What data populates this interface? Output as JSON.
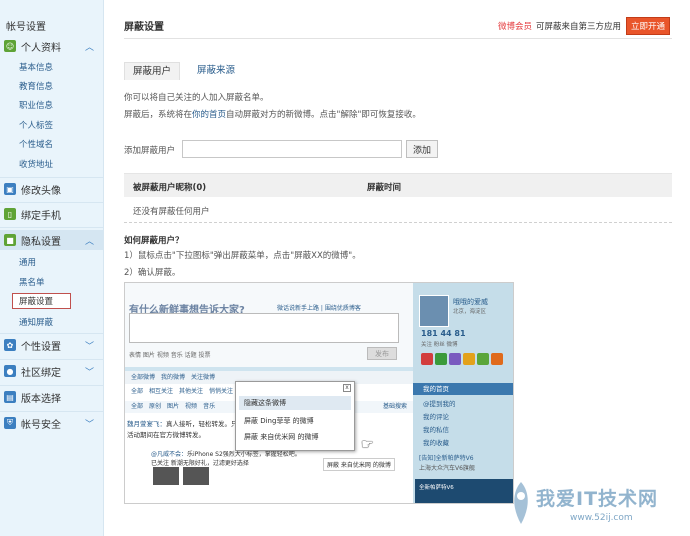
{
  "sidebar": {
    "title": "帐号设置",
    "sections": [
      {
        "label": "个人资料",
        "icon": "person-icon",
        "chevron": "^"
      },
      {
        "label": "修改头像",
        "icon": "avatar-icon"
      },
      {
        "label": "绑定手机",
        "icon": "phone-icon"
      },
      {
        "label": "隐私设置",
        "icon": "lock-icon",
        "chevron": "^"
      },
      {
        "label": "个性设置",
        "icon": "style-icon",
        "chevron": "v"
      },
      {
        "label": "社区绑定",
        "icon": "community-icon",
        "chevron": "v"
      },
      {
        "label": "版本选择",
        "icon": "version-icon"
      },
      {
        "label": "帐号安全",
        "icon": "shield-icon",
        "chevron": "v"
      }
    ],
    "profile_items": [
      "基本信息",
      "教育信息",
      "职业信息",
      "个人标签",
      "个性域名",
      "收货地址"
    ],
    "privacy_items": [
      "通用",
      "黑名单",
      "屏蔽设置",
      "通知屏蔽"
    ]
  },
  "header": {
    "title": "屏蔽设置",
    "vip_link": "微博会员",
    "vip_text": "可屏蔽来自第三方应用",
    "open_button": "立即开通"
  },
  "tabs": {
    "active": "屏蔽用户",
    "other": "屏蔽来源"
  },
  "desc": {
    "line1": "你可以将自己关注的人加入屏蔽名单。",
    "line2_a": "屏蔽后，系统将在",
    "line2_link": "你的首页",
    "line2_b": "自动屏蔽对方的新微博。点击\"解除\"即可恢复接收。"
  },
  "add": {
    "label": "添加屏蔽用户",
    "value": "",
    "button": "添加"
  },
  "table": {
    "col1": "被屏蔽用户昵称(0)",
    "col2": "屏蔽时间",
    "empty": "还没有屏蔽任何用户"
  },
  "howto": {
    "title": "如何屏蔽用户？",
    "step1": "1）鼠标点击\"下拉图标\"弹出屏蔽菜单，点击\"屏蔽XX的微博\"。",
    "step2": "2）确认屏蔽。"
  },
  "screenshot": {
    "question": "有什么新鲜事想告诉大家?",
    "links": "微话说新手上路 | 围绕优质博客",
    "tools": "表情  图片  视频  音乐  话题  投票",
    "post_btn": "发布",
    "feed_tabs": [
      "全部微博",
      "我的微博",
      "关注微博"
    ],
    "sub_tabs": [
      "全部",
      "相互关注",
      "其他关注",
      "悄悄关注"
    ],
    "sub_tabs2": [
      "全部",
      "原创",
      "图片",
      "视频",
      "音乐"
    ],
    "search": "基础搜索",
    "post1_user": "魏月萱宴飞：",
    "post1_text": "真人接听，轻松转发。只要在",
    "post1_text2": "活动期间在官方微博转发。",
    "post2_user": "@凡威不会：",
    "post2_text": "乐iPhone S2强烈大小标签，掌握轻松吧。",
    "post2_text2": "已关注 新潮无限好礼，过滤更好选择",
    "profile_name": "哦哦的爱威",
    "profile_loc": "北京，海淀区",
    "stats": "181 44 81",
    "stat_labels": "关注  粉丝  微博",
    "home": "我的首页",
    "menu": [
      "@提到我的",
      "我的评论",
      "我的私信",
      "我的收藏"
    ],
    "ad1": "[告知]全新帕萨特V6",
    "ad2": "上海大众汽车V6旗舰",
    "car_text": "全新帕萨特V6",
    "ctx_items": [
      "隐藏这条微博",
      "屏蔽 Ding菲菲 的微博",
      "屏蔽 来自优米网 的微博"
    ],
    "ctx_close": "x",
    "small_hide": "屏蔽 来自优米网 的微博"
  },
  "watermark": {
    "text": "我爱IT技术网",
    "url": "www.52ij.com"
  }
}
